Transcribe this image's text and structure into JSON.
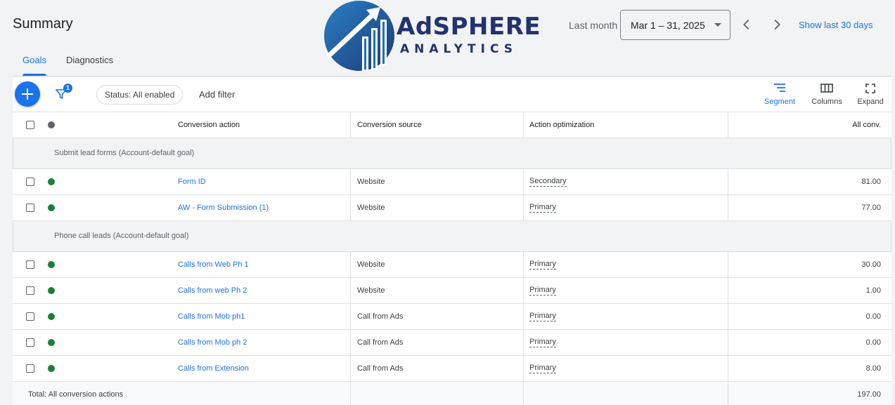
{
  "header": {
    "title": "Summary",
    "date_label": "Last month",
    "date_range": "Mar 1 – 31, 2025",
    "show_last": "Show last 30 days"
  },
  "logo": {
    "line1": "AdSPHERE",
    "line2": "ANALYTICS",
    "colors": {
      "primary": "#24336d",
      "accent": "#1f6fb3"
    }
  },
  "tabs": [
    {
      "label": "Goals",
      "active": true
    },
    {
      "label": "Diagnostics",
      "active": false
    }
  ],
  "toolbar": {
    "filter_count": "1",
    "status_chip": "Status: All enabled",
    "add_filter": "Add filter",
    "segment": "Segment",
    "columns": "Columns",
    "expand": "Expand"
  },
  "table": {
    "columns": {
      "action": "Conversion action",
      "source": "Conversion source",
      "optimization": "Action optimization",
      "conv": "All conv."
    },
    "groups": [
      {
        "label": "Submit lead forms (Account-default goal)",
        "rows": [
          {
            "action": "Form ID",
            "source": "Website",
            "optimization": "Secondary",
            "conv": "81.00"
          },
          {
            "action": "AW - Form Submission (1)",
            "source": "Website",
            "optimization": "Primary",
            "conv": "77.00"
          }
        ]
      },
      {
        "label": "Phone call leads (Account-default goal)",
        "rows": [
          {
            "action": "Calls from Web Ph 1",
            "source": "Website",
            "optimization": "Primary",
            "conv": "30.00"
          },
          {
            "action": "Calls from web Ph 2",
            "source": "Website",
            "optimization": "Primary",
            "conv": "1.00"
          },
          {
            "action": "Calls from Mob ph1",
            "source": "Call from Ads",
            "optimization": "Primary",
            "conv": "0.00"
          },
          {
            "action": "Calls from Mob ph 2",
            "source": "Call from Ads",
            "optimization": "Primary",
            "conv": "0.00"
          },
          {
            "action": "Calls from Extension",
            "source": "Call from Ads",
            "optimization": "Primary",
            "conv": "8.00"
          }
        ]
      }
    ],
    "total": {
      "label": "Total: All conversion actions",
      "conv": "197.00"
    }
  },
  "colors": {
    "accent": "#1a73e8",
    "enabled": "#188038"
  }
}
